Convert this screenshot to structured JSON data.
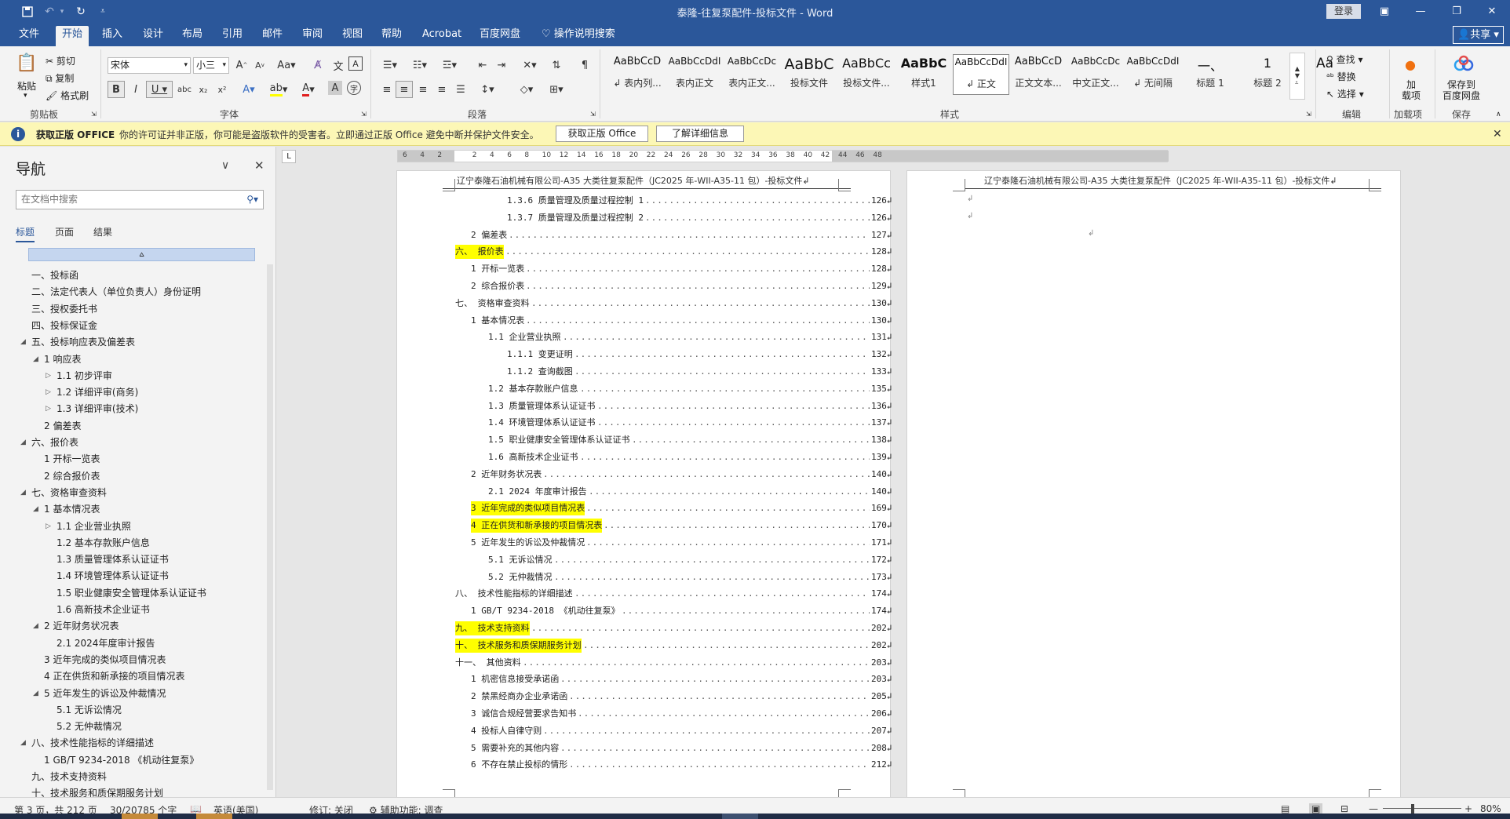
{
  "window": {
    "title": "泰隆-往复泵配件-投标文件 - Word",
    "login_label": "登录",
    "share_label": "共享"
  },
  "ribbon_tabs": [
    "文件",
    "开始",
    "插入",
    "设计",
    "布局",
    "引用",
    "邮件",
    "审阅",
    "视图",
    "帮助",
    "Acrobat",
    "百度网盘"
  ],
  "active_tab": "开始",
  "tell_me": "操作说明搜索",
  "ribbon": {
    "clipboard": {
      "paste": "粘贴",
      "cut": "剪切",
      "copy": "复制",
      "format_painter": "格式刷",
      "label": "剪贴板"
    },
    "font": {
      "name": "宋体",
      "size": "小三",
      "label": "字体"
    },
    "paragraph": {
      "label": "段落"
    },
    "styles": {
      "label": "样式",
      "items": [
        {
          "preview": "AaBbCcD",
          "name": "↲ 表内列..."
        },
        {
          "preview": "AaBbCcDdI",
          "name": "表内正文"
        },
        {
          "preview": "AaBbCcDc",
          "name": "表内正文..."
        },
        {
          "preview": "AaBbC",
          "name": "投标文件"
        },
        {
          "preview": "AaBbCc",
          "name": "投标文件..."
        },
        {
          "preview": "AaBbC",
          "name": "样式1"
        },
        {
          "preview": "AaBbCcDdI",
          "name": "↲ 正文"
        },
        {
          "preview": "AaBbCcD",
          "name": "正文文本..."
        },
        {
          "preview": "AaBbCcDc",
          "name": "中文正文..."
        },
        {
          "preview": "AaBbCcDdI",
          "name": "↲ 无间隔"
        },
        {
          "preview": "一、",
          "name": "标题 1"
        },
        {
          "preview": "1",
          "name": "标题 2"
        },
        {
          "preview": "Aa",
          "name": ""
        }
      ]
    },
    "editing": {
      "find": "查找",
      "replace": "替换",
      "select": "选择",
      "label": "编辑"
    },
    "addins": {
      "btn": "加\n载项",
      "label": "加载项"
    },
    "save": {
      "btn": "保存到\n百度网盘",
      "label": "保存"
    }
  },
  "license_bar": {
    "title": "获取正版 OFFICE",
    "message": "你的许可证并非正版，你可能是盗版软件的受害者。立即通过正版 Office 避免中断并保护文件安全。",
    "btn_get": "获取正版 Office",
    "btn_more": "了解详细信息"
  },
  "nav": {
    "title": "导航",
    "search_placeholder": "在文档中搜索",
    "tabs": [
      "标题",
      "页面",
      "结果"
    ],
    "items": [
      {
        "level": 1,
        "text": "一、投标函",
        "arrow": ""
      },
      {
        "level": 1,
        "text": "二、法定代表人（单位负责人）身份证明",
        "arrow": ""
      },
      {
        "level": 1,
        "text": "三、授权委托书",
        "arrow": ""
      },
      {
        "level": 1,
        "text": "四、投标保证金",
        "arrow": ""
      },
      {
        "level": 1,
        "text": "五、投标响应表及偏差表",
        "arrow": "▲"
      },
      {
        "level": 2,
        "text": "1 响应表",
        "arrow": "▲"
      },
      {
        "level": 3,
        "text": "1.1 初步评审",
        "arrow": "▷"
      },
      {
        "level": 3,
        "text": "1.2 详细评审(商务)",
        "arrow": "▷"
      },
      {
        "level": 3,
        "text": "1.3 详细评审(技术)",
        "arrow": "▷"
      },
      {
        "level": 2,
        "text": "2 偏差表",
        "arrow": ""
      },
      {
        "level": 1,
        "text": "六、报价表",
        "arrow": "▲"
      },
      {
        "level": 2,
        "text": "1 开标一览表",
        "arrow": ""
      },
      {
        "level": 2,
        "text": "2 综合报价表",
        "arrow": ""
      },
      {
        "level": 1,
        "text": "七、资格审查资料",
        "arrow": "▲"
      },
      {
        "level": 2,
        "text": "1 基本情况表",
        "arrow": "▲"
      },
      {
        "level": 3,
        "text": "1.1 企业营业执照",
        "arrow": "▷"
      },
      {
        "level": 3,
        "text": "1.2 基本存款账户信息",
        "arrow": ""
      },
      {
        "level": 3,
        "text": "1.3 质量管理体系认证证书",
        "arrow": ""
      },
      {
        "level": 3,
        "text": "1.4 环境管理体系认证证书",
        "arrow": ""
      },
      {
        "level": 3,
        "text": "1.5 职业健康安全管理体系认证证书",
        "arrow": ""
      },
      {
        "level": 3,
        "text": "1.6 高新技术企业证书",
        "arrow": ""
      },
      {
        "level": 2,
        "text": "2 近年财务状况表",
        "arrow": "▲"
      },
      {
        "level": 3,
        "text": "2.1 2024年度审计报告",
        "arrow": ""
      },
      {
        "level": 2,
        "text": "3 近年完成的类似项目情况表",
        "arrow": ""
      },
      {
        "level": 2,
        "text": "4 正在供货和新承接的项目情况表",
        "arrow": ""
      },
      {
        "level": 2,
        "text": "5 近年发生的诉讼及仲裁情况",
        "arrow": "▲"
      },
      {
        "level": 3,
        "text": "5.1 无诉讼情况",
        "arrow": ""
      },
      {
        "level": 3,
        "text": "5.2 无仲裁情况",
        "arrow": ""
      },
      {
        "level": 1,
        "text": "八、技术性能指标的详细描述",
        "arrow": "▲"
      },
      {
        "level": 2,
        "text": "1 GB/T 9234-2018 《机动往复泵》",
        "arrow": ""
      },
      {
        "level": 1,
        "text": "九、技术支持资料",
        "arrow": ""
      },
      {
        "level": 1,
        "text": "十、技术服务和质保期服务计划",
        "arrow": ""
      }
    ]
  },
  "ruler_numbers": [
    "6",
    "4",
    "2",
    "",
    "2",
    "4",
    "6",
    "8",
    "10",
    "12",
    "14",
    "16",
    "18",
    "20",
    "22",
    "24",
    "26",
    "28",
    "30",
    "32",
    "34",
    "36",
    "38",
    "40",
    "42",
    "44",
    "46",
    "48"
  ],
  "page_header": "辽宁泰隆石油机械有限公司-A35 大类往复泵配件（JC2025 年-WII-A35-11 包）-投标文件↲",
  "toc": [
    {
      "indent": 3,
      "text": "1.3.6 质量管理及质量过程控制 1",
      "page": "126↲",
      "hl": false
    },
    {
      "indent": 3,
      "text": "1.3.7 质量管理及质量过程控制 2",
      "page": "126↲",
      "hl": false
    },
    {
      "indent": 1,
      "text": "2 偏差表",
      "page": "127↲",
      "hl": false
    },
    {
      "indent": 0,
      "text": "六、 报价表",
      "page": "128↲",
      "hl": true
    },
    {
      "indent": 1,
      "text": "1 开标一览表",
      "page": "128↲",
      "hl": false
    },
    {
      "indent": 1,
      "text": "2 综合报价表",
      "page": "129↲",
      "hl": false
    },
    {
      "indent": 0,
      "text": "七、 资格审查资料",
      "page": "130↲",
      "hl": false
    },
    {
      "indent": 1,
      "text": "1 基本情况表",
      "page": "130↲",
      "hl": false
    },
    {
      "indent": 2,
      "text": "1.1 企业营业执照",
      "page": "131↲",
      "hl": false
    },
    {
      "indent": 3,
      "text": "1.1.1 变更证明",
      "page": "132↲",
      "hl": false
    },
    {
      "indent": 3,
      "text": "1.1.2 查询截图",
      "page": "133↲",
      "hl": false
    },
    {
      "indent": 2,
      "text": "1.2 基本存款账户信息",
      "page": "135↲",
      "hl": false
    },
    {
      "indent": 2,
      "text": "1.3 质量管理体系认证证书",
      "page": "136↲",
      "hl": false
    },
    {
      "indent": 2,
      "text": "1.4 环境管理体系认证证书",
      "page": "137↲",
      "hl": false
    },
    {
      "indent": 2,
      "text": "1.5 职业健康安全管理体系认证证书",
      "page": "138↲",
      "hl": false
    },
    {
      "indent": 2,
      "text": "1.6 高新技术企业证书",
      "page": "139↲",
      "hl": false
    },
    {
      "indent": 1,
      "text": "2 近年财务状况表",
      "page": "140↲",
      "hl": false
    },
    {
      "indent": 2,
      "text": "2.1 2024 年度审计报告",
      "page": "140↲",
      "hl": false
    },
    {
      "indent": 1,
      "text": "3 近年完成的类似项目情况表",
      "page": "169↲",
      "hl": true
    },
    {
      "indent": 1,
      "text": "4 正在供货和新承接的项目情况表",
      "page": "170↲",
      "hl": true
    },
    {
      "indent": 1,
      "text": "5 近年发生的诉讼及仲裁情况",
      "page": "171↲",
      "hl": false
    },
    {
      "indent": 2,
      "text": "5.1 无诉讼情况",
      "page": "172↲",
      "hl": false
    },
    {
      "indent": 2,
      "text": "5.2 无仲裁情况",
      "page": "173↲",
      "hl": false
    },
    {
      "indent": 0,
      "text": "八、 技术性能指标的详细描述",
      "page": "174↲",
      "hl": false
    },
    {
      "indent": 1,
      "text": "1 GB/T 9234-2018 《机动往复泵》",
      "page": "174↲",
      "hl": false
    },
    {
      "indent": 0,
      "text": "九、 技术支持资料",
      "page": "202↲",
      "hl": true
    },
    {
      "indent": 0,
      "text": "十、 技术服务和质保期服务计划",
      "page": "202↲",
      "hl": true
    },
    {
      "indent": 0,
      "text": "十一、 其他资料",
      "page": "203↲",
      "hl": false
    },
    {
      "indent": 1,
      "text": "1 机密信息接受承诺函",
      "page": "203↲",
      "hl": false
    },
    {
      "indent": 1,
      "text": "2 禁黑经商办企业承诺函",
      "page": "205↲",
      "hl": false
    },
    {
      "indent": 1,
      "text": "3 诚信合规经营要求告知书",
      "page": "206↲",
      "hl": false
    },
    {
      "indent": 1,
      "text": "4 投标人自律守则",
      "page": "207↲",
      "hl": false
    },
    {
      "indent": 1,
      "text": "5 需要补充的其他内容",
      "page": "208↲",
      "hl": false
    },
    {
      "indent": 1,
      "text": "6 不存在禁止投标的情形",
      "page": "212↲",
      "hl": false
    }
  ],
  "page2_marks": [
    "↲",
    "↲",
    "↲"
  ],
  "status": {
    "page": "第 3 页，共 212 页",
    "words": "30/20785 个字",
    "lang": "英语(美国)",
    "track": "修订: 关闭",
    "access": "辅助功能: 调查",
    "zoom": "80%"
  },
  "colors": {
    "brand": "#2b579a",
    "highlight": "#ffff00",
    "license_bar": "#fcf7b6"
  }
}
